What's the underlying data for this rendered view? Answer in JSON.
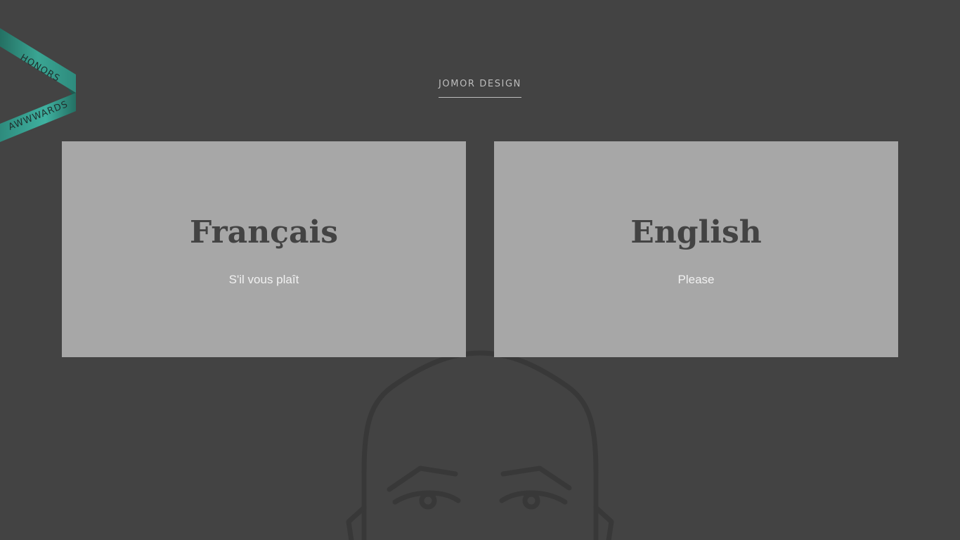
{
  "brand": {
    "title": "JOMOR DESIGN"
  },
  "languages": [
    {
      "title": "Français",
      "subtitle": "S'il vous plaît"
    },
    {
      "title": "English",
      "subtitle": "Please"
    }
  ],
  "ribbon": {
    "top_text": "HONORS",
    "bottom_text": "AWWWARDS",
    "color": "#2e8b7d",
    "highlight_color": "#3fb1a0"
  },
  "colors": {
    "background": "#434343",
    "card": "#a7a7a7",
    "heading": "#434343",
    "subtitle": "#f1f1f1",
    "brand_text": "#bdbdbd"
  }
}
